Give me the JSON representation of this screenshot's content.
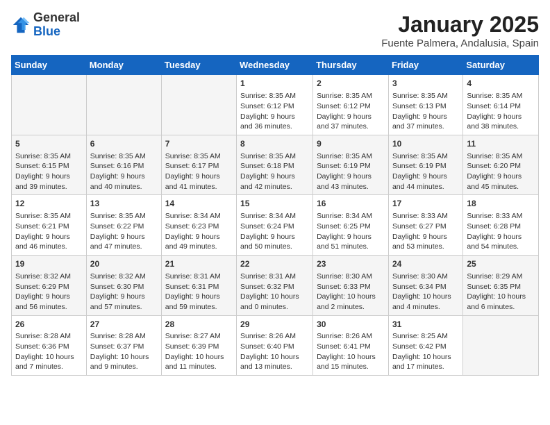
{
  "header": {
    "logo_general": "General",
    "logo_blue": "Blue",
    "month_title": "January 2025",
    "location": "Fuente Palmera, Andalusia, Spain"
  },
  "weekdays": [
    "Sunday",
    "Monday",
    "Tuesday",
    "Wednesday",
    "Thursday",
    "Friday",
    "Saturday"
  ],
  "weeks": [
    [
      {
        "day": "",
        "sunrise": "",
        "sunset": "",
        "daylight": ""
      },
      {
        "day": "",
        "sunrise": "",
        "sunset": "",
        "daylight": ""
      },
      {
        "day": "",
        "sunrise": "",
        "sunset": "",
        "daylight": ""
      },
      {
        "day": "1",
        "sunrise": "Sunrise: 8:35 AM",
        "sunset": "Sunset: 6:12 PM",
        "daylight": "Daylight: 9 hours and 36 minutes."
      },
      {
        "day": "2",
        "sunrise": "Sunrise: 8:35 AM",
        "sunset": "Sunset: 6:12 PM",
        "daylight": "Daylight: 9 hours and 37 minutes."
      },
      {
        "day": "3",
        "sunrise": "Sunrise: 8:35 AM",
        "sunset": "Sunset: 6:13 PM",
        "daylight": "Daylight: 9 hours and 37 minutes."
      },
      {
        "day": "4",
        "sunrise": "Sunrise: 8:35 AM",
        "sunset": "Sunset: 6:14 PM",
        "daylight": "Daylight: 9 hours and 38 minutes."
      }
    ],
    [
      {
        "day": "5",
        "sunrise": "Sunrise: 8:35 AM",
        "sunset": "Sunset: 6:15 PM",
        "daylight": "Daylight: 9 hours and 39 minutes."
      },
      {
        "day": "6",
        "sunrise": "Sunrise: 8:35 AM",
        "sunset": "Sunset: 6:16 PM",
        "daylight": "Daylight: 9 hours and 40 minutes."
      },
      {
        "day": "7",
        "sunrise": "Sunrise: 8:35 AM",
        "sunset": "Sunset: 6:17 PM",
        "daylight": "Daylight: 9 hours and 41 minutes."
      },
      {
        "day": "8",
        "sunrise": "Sunrise: 8:35 AM",
        "sunset": "Sunset: 6:18 PM",
        "daylight": "Daylight: 9 hours and 42 minutes."
      },
      {
        "day": "9",
        "sunrise": "Sunrise: 8:35 AM",
        "sunset": "Sunset: 6:19 PM",
        "daylight": "Daylight: 9 hours and 43 minutes."
      },
      {
        "day": "10",
        "sunrise": "Sunrise: 8:35 AM",
        "sunset": "Sunset: 6:19 PM",
        "daylight": "Daylight: 9 hours and 44 minutes."
      },
      {
        "day": "11",
        "sunrise": "Sunrise: 8:35 AM",
        "sunset": "Sunset: 6:20 PM",
        "daylight": "Daylight: 9 hours and 45 minutes."
      }
    ],
    [
      {
        "day": "12",
        "sunrise": "Sunrise: 8:35 AM",
        "sunset": "Sunset: 6:21 PM",
        "daylight": "Daylight: 9 hours and 46 minutes."
      },
      {
        "day": "13",
        "sunrise": "Sunrise: 8:35 AM",
        "sunset": "Sunset: 6:22 PM",
        "daylight": "Daylight: 9 hours and 47 minutes."
      },
      {
        "day": "14",
        "sunrise": "Sunrise: 8:34 AM",
        "sunset": "Sunset: 6:23 PM",
        "daylight": "Daylight: 9 hours and 49 minutes."
      },
      {
        "day": "15",
        "sunrise": "Sunrise: 8:34 AM",
        "sunset": "Sunset: 6:24 PM",
        "daylight": "Daylight: 9 hours and 50 minutes."
      },
      {
        "day": "16",
        "sunrise": "Sunrise: 8:34 AM",
        "sunset": "Sunset: 6:25 PM",
        "daylight": "Daylight: 9 hours and 51 minutes."
      },
      {
        "day": "17",
        "sunrise": "Sunrise: 8:33 AM",
        "sunset": "Sunset: 6:27 PM",
        "daylight": "Daylight: 9 hours and 53 minutes."
      },
      {
        "day": "18",
        "sunrise": "Sunrise: 8:33 AM",
        "sunset": "Sunset: 6:28 PM",
        "daylight": "Daylight: 9 hours and 54 minutes."
      }
    ],
    [
      {
        "day": "19",
        "sunrise": "Sunrise: 8:32 AM",
        "sunset": "Sunset: 6:29 PM",
        "daylight": "Daylight: 9 hours and 56 minutes."
      },
      {
        "day": "20",
        "sunrise": "Sunrise: 8:32 AM",
        "sunset": "Sunset: 6:30 PM",
        "daylight": "Daylight: 9 hours and 57 minutes."
      },
      {
        "day": "21",
        "sunrise": "Sunrise: 8:31 AM",
        "sunset": "Sunset: 6:31 PM",
        "daylight": "Daylight: 9 hours and 59 minutes."
      },
      {
        "day": "22",
        "sunrise": "Sunrise: 8:31 AM",
        "sunset": "Sunset: 6:32 PM",
        "daylight": "Daylight: 10 hours and 0 minutes."
      },
      {
        "day": "23",
        "sunrise": "Sunrise: 8:30 AM",
        "sunset": "Sunset: 6:33 PM",
        "daylight": "Daylight: 10 hours and 2 minutes."
      },
      {
        "day": "24",
        "sunrise": "Sunrise: 8:30 AM",
        "sunset": "Sunset: 6:34 PM",
        "daylight": "Daylight: 10 hours and 4 minutes."
      },
      {
        "day": "25",
        "sunrise": "Sunrise: 8:29 AM",
        "sunset": "Sunset: 6:35 PM",
        "daylight": "Daylight: 10 hours and 6 minutes."
      }
    ],
    [
      {
        "day": "26",
        "sunrise": "Sunrise: 8:28 AM",
        "sunset": "Sunset: 6:36 PM",
        "daylight": "Daylight: 10 hours and 7 minutes."
      },
      {
        "day": "27",
        "sunrise": "Sunrise: 8:28 AM",
        "sunset": "Sunset: 6:37 PM",
        "daylight": "Daylight: 10 hours and 9 minutes."
      },
      {
        "day": "28",
        "sunrise": "Sunrise: 8:27 AM",
        "sunset": "Sunset: 6:39 PM",
        "daylight": "Daylight: 10 hours and 11 minutes."
      },
      {
        "day": "29",
        "sunrise": "Sunrise: 8:26 AM",
        "sunset": "Sunset: 6:40 PM",
        "daylight": "Daylight: 10 hours and 13 minutes."
      },
      {
        "day": "30",
        "sunrise": "Sunrise: 8:26 AM",
        "sunset": "Sunset: 6:41 PM",
        "daylight": "Daylight: 10 hours and 15 minutes."
      },
      {
        "day": "31",
        "sunrise": "Sunrise: 8:25 AM",
        "sunset": "Sunset: 6:42 PM",
        "daylight": "Daylight: 10 hours and 17 minutes."
      },
      {
        "day": "",
        "sunrise": "",
        "sunset": "",
        "daylight": ""
      }
    ]
  ]
}
